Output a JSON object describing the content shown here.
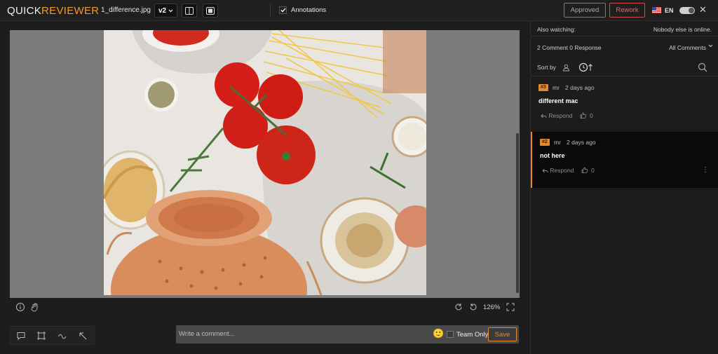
{
  "header": {
    "logo_main": "QUICK",
    "logo_accent": "REVIEWER",
    "filename": "1_difference.jpg",
    "version": "v2",
    "annotations_label": "Annotations",
    "annotations_checked": true,
    "approved_label": "Approved",
    "rework_label": "Rework",
    "language": "EN",
    "close_icon": "close-icon"
  },
  "canvas": {
    "zoom": "126%"
  },
  "comment_box": {
    "placeholder": "Write a comment...",
    "team_only_label": "Team Only",
    "save_label": "Save"
  },
  "sidebar": {
    "also_watching_label": "Also watching:",
    "online_status": "Nobody else is online.",
    "counts_label": "2 Comment 0 Response",
    "filter_label": "All Comments",
    "sort_label": "Sort by",
    "comments": [
      {
        "badge": "#3",
        "author": "mr",
        "time": "2 days ago",
        "text": "different mac",
        "respond_label": "Respond",
        "likes": "0"
      },
      {
        "badge": "#2",
        "author": "mr",
        "time": "2 days ago",
        "text": "not here",
        "respond_label": "Respond",
        "likes": "0"
      }
    ]
  },
  "colors": {
    "accent": "#e58a2c",
    "rework": "#d54a4a",
    "background": "#1d1d1d"
  }
}
